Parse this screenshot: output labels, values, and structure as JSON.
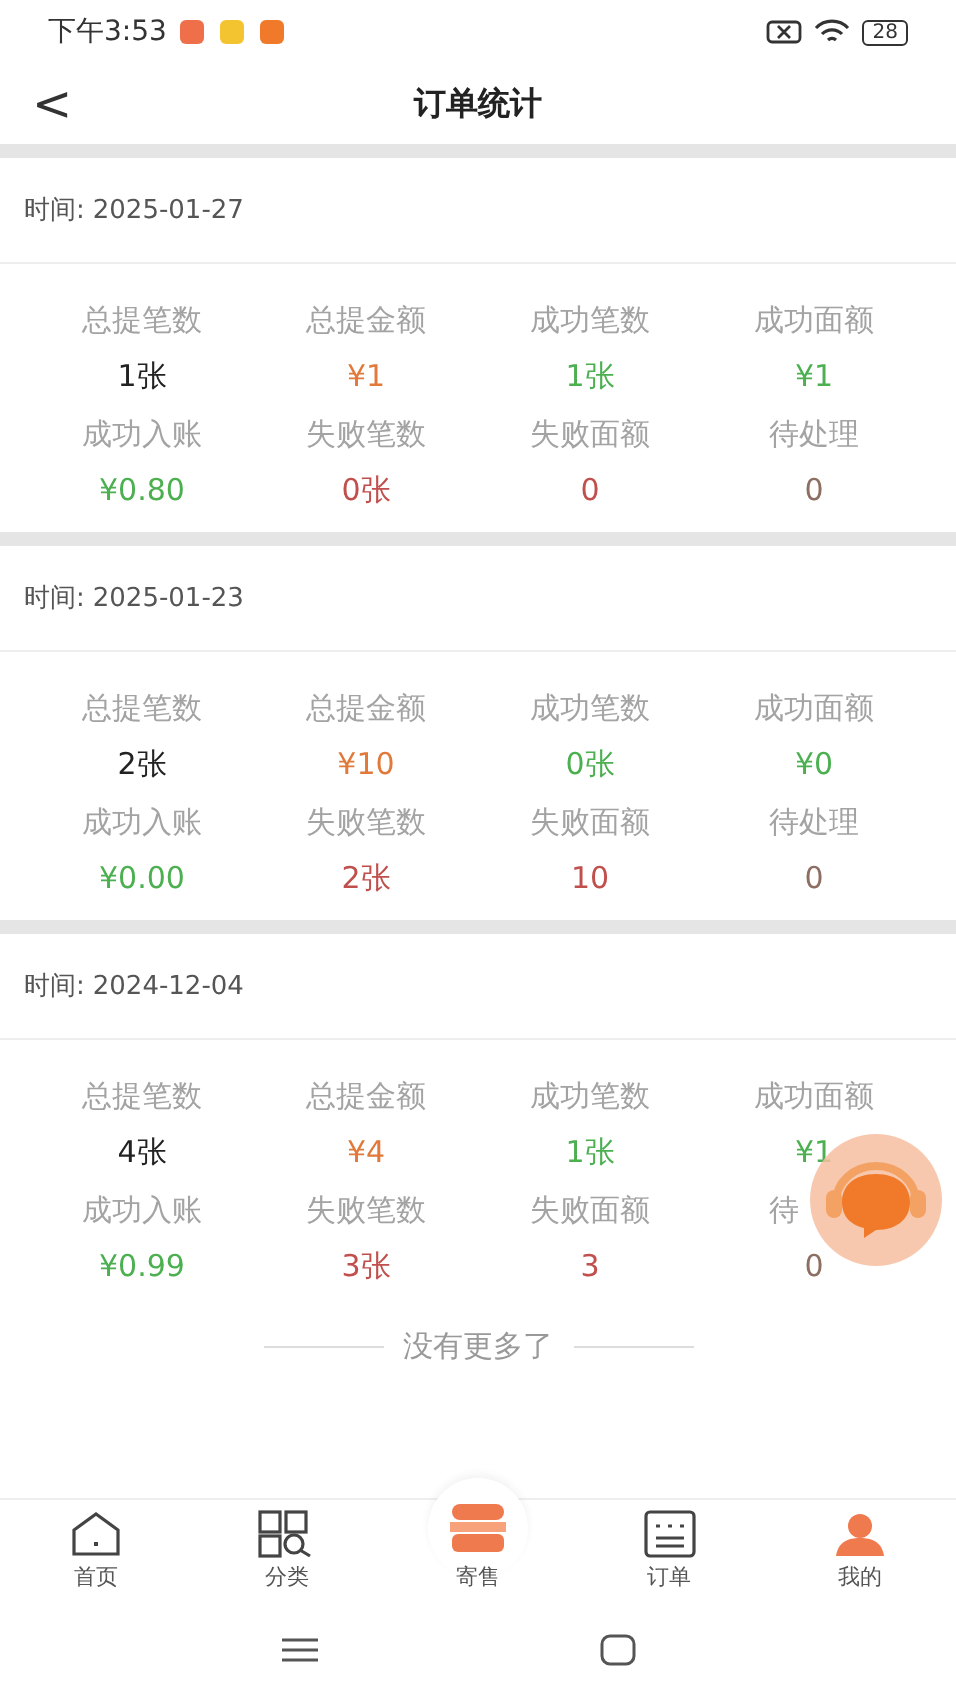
{
  "status_bar": {
    "time": "下午3:53",
    "battery": "28"
  },
  "header": {
    "back": "<",
    "title": "订单统计"
  },
  "records": [
    {
      "date_label": "时间:",
      "date": "2025-01-27",
      "stats": [
        {
          "label": "总提笔数",
          "value": "1张",
          "color": "#222222"
        },
        {
          "label": "总提金额",
          "value": "¥1",
          "color": "#e0793a"
        },
        {
          "label": "成功笔数",
          "value": "1张",
          "color": "#4caf50"
        },
        {
          "label": "成功面额",
          "value": "¥1",
          "color": "#4caf50"
        },
        {
          "label": "成功入账",
          "value": "¥0.80",
          "color": "#4caf50"
        },
        {
          "label": "失败笔数",
          "value": "0张",
          "color": "#c0504d"
        },
        {
          "label": "失败面额",
          "value": "0",
          "color": "#c0504d"
        },
        {
          "label": "待处理",
          "value": "0",
          "color": "#8d6e63"
        }
      ]
    },
    {
      "date_label": "时间:",
      "date": "2025-01-23",
      "stats": [
        {
          "label": "总提笔数",
          "value": "2张",
          "color": "#222222"
        },
        {
          "label": "总提金额",
          "value": "¥10",
          "color": "#e0793a"
        },
        {
          "label": "成功笔数",
          "value": "0张",
          "color": "#4caf50"
        },
        {
          "label": "成功面额",
          "value": "¥0",
          "color": "#4caf50"
        },
        {
          "label": "成功入账",
          "value": "¥0.00",
          "color": "#4caf50"
        },
        {
          "label": "失败笔数",
          "value": "2张",
          "color": "#c0504d"
        },
        {
          "label": "失败面额",
          "value": "10",
          "color": "#c0504d"
        },
        {
          "label": "待处理",
          "value": "0",
          "color": "#8d6e63"
        }
      ]
    },
    {
      "date_label": "时间:",
      "date": "2024-12-04",
      "stats": [
        {
          "label": "总提笔数",
          "value": "4张",
          "color": "#222222"
        },
        {
          "label": "总提金额",
          "value": "¥4",
          "color": "#e0793a"
        },
        {
          "label": "成功笔数",
          "value": "1张",
          "color": "#4caf50"
        },
        {
          "label": "成功面额",
          "value": "¥1",
          "color": "#4caf50"
        },
        {
          "label": "成功入账",
          "value": "¥0.99",
          "color": "#4caf50"
        },
        {
          "label": "失败笔数",
          "value": "3张",
          "color": "#c0504d"
        },
        {
          "label": "失败面额",
          "value": "3",
          "color": "#c0504d"
        },
        {
          "label": "待",
          "value": "0",
          "color": "#8d6e63",
          "cut_off": true
        }
      ]
    }
  ],
  "end_note": "没有更多了",
  "tabs": [
    {
      "label": "首页",
      "kind": "home",
      "selected": false
    },
    {
      "label": "分类",
      "kind": "category",
      "selected": false
    },
    {
      "label": "寄售",
      "kind": "consign",
      "selected": false
    },
    {
      "label": "订单",
      "kind": "orders",
      "selected": false
    },
    {
      "label": "我的",
      "kind": "profile",
      "selected": true
    }
  ]
}
